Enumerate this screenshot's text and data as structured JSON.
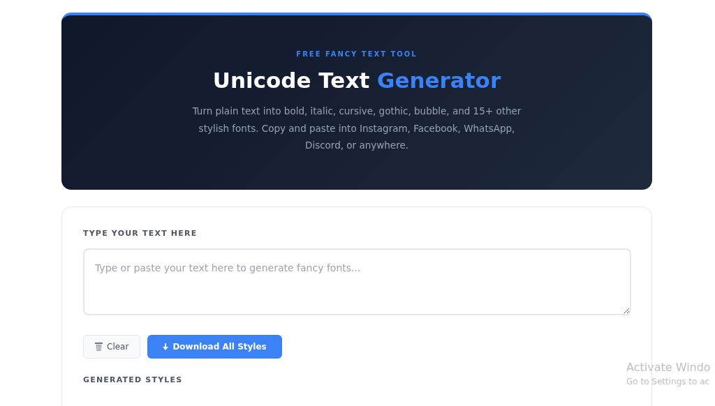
{
  "hero": {
    "tagline": "FREE FANCY TEXT TOOL",
    "title_start": "Unicode Text",
    "title_accent": "Generator",
    "description": "Turn plain text into bold, italic, cursive, gothic, bubble, and 15+ other stylish fonts. Copy and paste into Instagram, Facebook, WhatsApp, Discord, or anywhere."
  },
  "editor": {
    "label": "TYPE YOUR TEXT HERE",
    "input": {
      "placeholder": "Type or paste your text here to generate fancy fonts..."
    },
    "buttons": [
      {
        "kind": "clear",
        "label": "Clear"
      },
      {
        "kind": "download",
        "label": "Download All Styles"
      }
    ],
    "results_heading": "GENERATED STYLES"
  },
  "os_notice": {
    "title": "Activate Windo",
    "subtitle": "Go to Settings to ac"
  }
}
